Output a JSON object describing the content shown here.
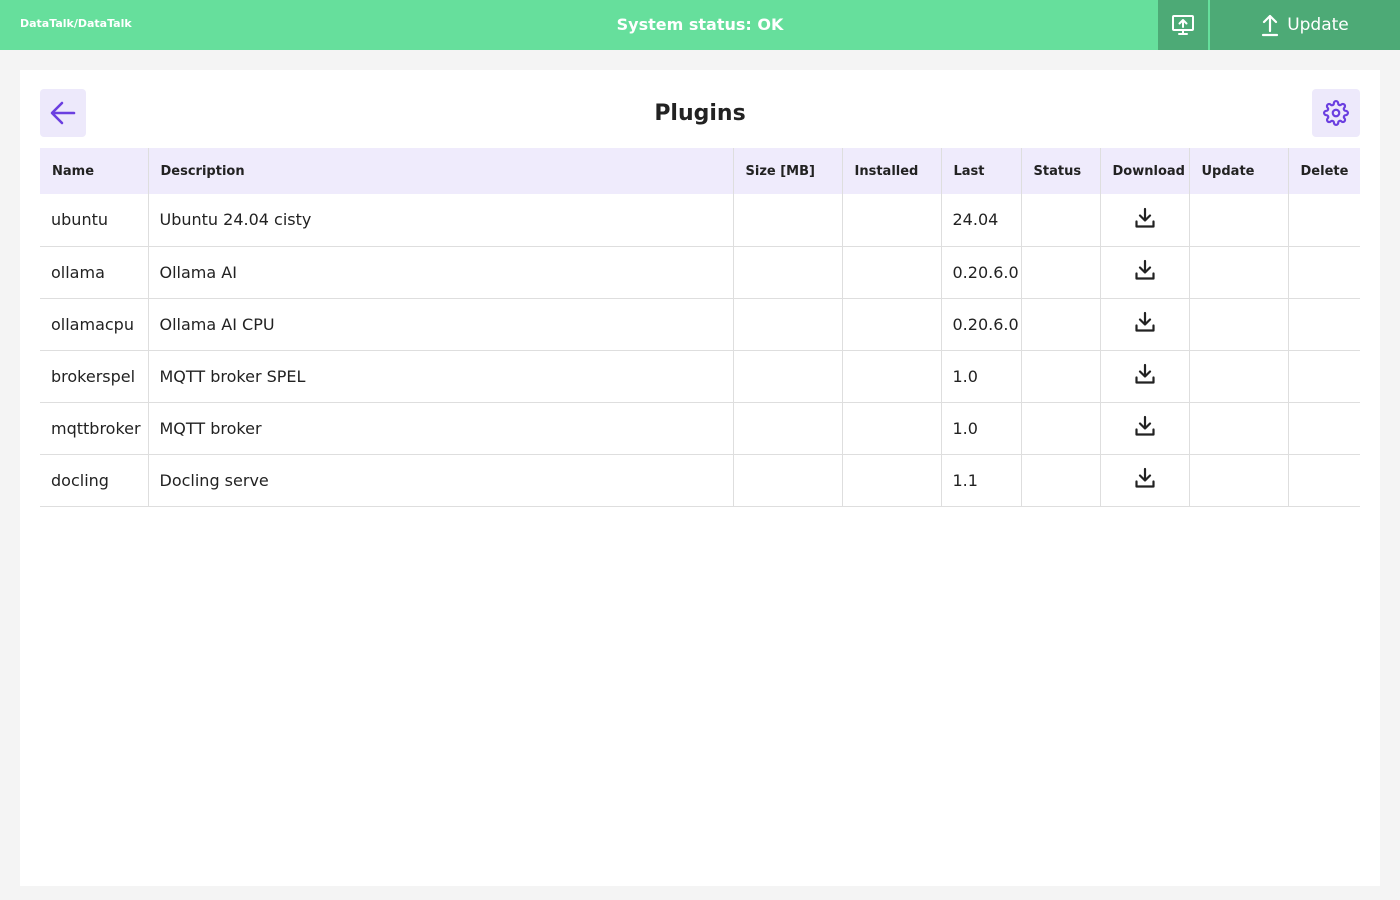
{
  "header": {
    "brand": "DataTalk/DataTalk",
    "status": "System status: OK",
    "update_label": "Update",
    "icons": {
      "monitor": "monitor-upload-icon",
      "upload": "upload-arrow-icon"
    }
  },
  "page": {
    "title": "Plugins",
    "icons": {
      "back": "arrow-left-icon",
      "settings": "gear-icon"
    }
  },
  "table": {
    "columns": [
      "Name",
      "Description",
      "Size [MB]",
      "Installed",
      "Last",
      "Status",
      "Download",
      "Update",
      "Delete"
    ],
    "rows": [
      {
        "name": "ubuntu",
        "description": "Ubuntu 24.04 cisty",
        "size": "",
        "installed": "",
        "last": "24.04",
        "status": ""
      },
      {
        "name": "ollama",
        "description": "Ollama AI",
        "size": "",
        "installed": "",
        "last": "0.20.6.0",
        "status": ""
      },
      {
        "name": "ollamacpu",
        "description": "Ollama AI CPU",
        "size": "",
        "installed": "",
        "last": "0.20.6.0",
        "status": ""
      },
      {
        "name": "brokerspel",
        "description": "MQTT broker SPEL",
        "size": "",
        "installed": "",
        "last": "1.0",
        "status": ""
      },
      {
        "name": "mqttbroker",
        "description": "MQTT broker",
        "size": "",
        "installed": "",
        "last": "1.0",
        "status": ""
      },
      {
        "name": "docling",
        "description": "Docling serve",
        "size": "",
        "installed": "",
        "last": "1.1",
        "status": ""
      }
    ],
    "download_icon": "download-icon"
  },
  "colors": {
    "header_bg": "#66df9c",
    "header_button_bg": "#4daa76",
    "accent": "#6b3fe0",
    "table_header_bg": "#efebfc"
  }
}
